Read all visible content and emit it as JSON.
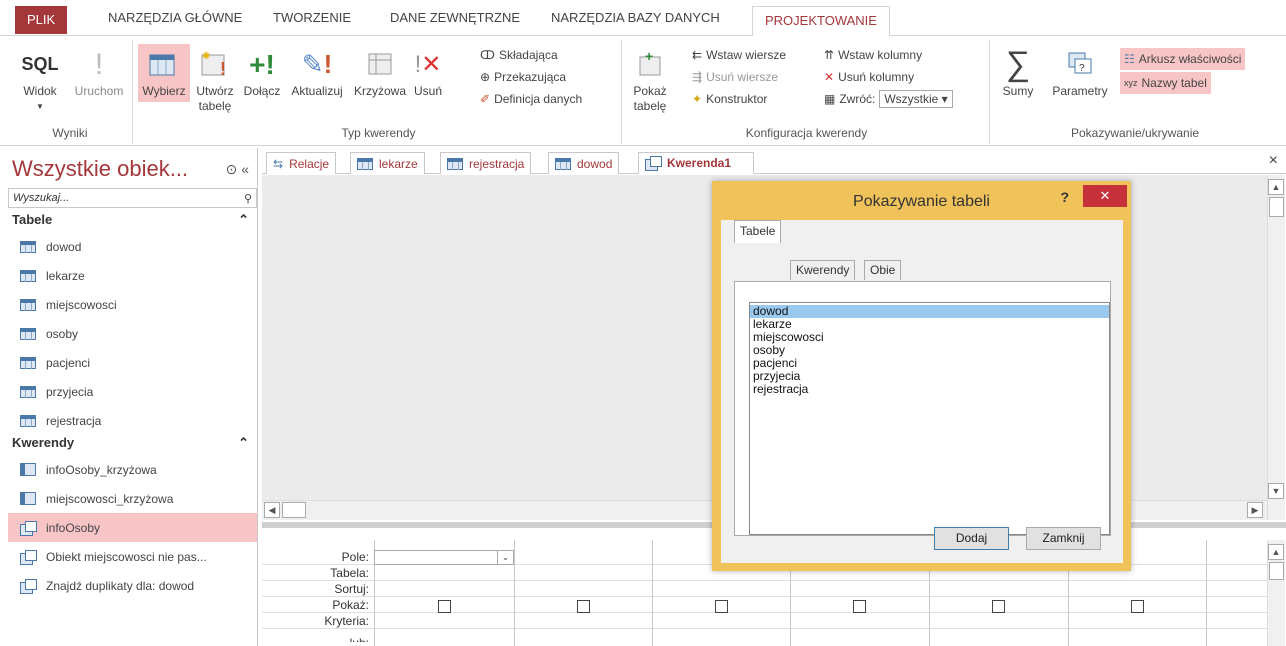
{
  "ribbon_tabs": [
    "PLIK",
    "NARZĘDZIA GŁÓWNE",
    "TWORZENIE",
    "DANE ZEWNĘTRZNE",
    "NARZĘDZIA BAZY DANYCH",
    "PROJEKTOWANIE"
  ],
  "ribbon": {
    "wyniki": {
      "label": "Wyniki",
      "widok": "Widok",
      "sql": "SQL",
      "uruchom": "Uruchom"
    },
    "typ": {
      "label": "Typ kwerendy",
      "wybierz": "Wybierz",
      "utworz1": "Utwórz",
      "utworz2": "tabelę",
      "dolacz": "Dołącz",
      "aktualizuj": "Aktualizuj",
      "krzyzowa": "Krzyżowa",
      "usun": "Usuń",
      "skladajaca": "Składająca",
      "przekazujaca": "Przekazująca",
      "definicja": "Definicja danych"
    },
    "konf": {
      "label": "Konfiguracja kwerendy",
      "pokaz1": "Pokaż",
      "pokaz2": "tabelę",
      "wstaw_wiersze": "Wstaw wiersze",
      "usun_wiersze": "Usuń wiersze",
      "konstruktor": "Konstruktor",
      "wstaw_kolumny": "Wstaw kolumny",
      "usun_kolumny": "Usuń kolumny",
      "zwroc": "Zwróć:",
      "zwroc_val": "Wszystkie"
    },
    "pokaz": {
      "label": "Pokazywanie/ukrywanie",
      "sumy": "Sumy",
      "parametry": "Parametry",
      "arkusz": "Arkusz właściwości",
      "nazwy": "Nazwy tabel"
    }
  },
  "nav": {
    "title": "Wszystkie obiek...",
    "search_placeholder": "Wyszukaj...",
    "tables_header": "Tabele",
    "tables": [
      "dowod",
      "lekarze",
      "miejscowosci",
      "osoby",
      "pacjenci",
      "przyjecia",
      "rejestracja"
    ],
    "queries_header": "Kwerendy",
    "queries": [
      "infoOsoby_krzyżowa",
      "miejscowosci_krzyżowa",
      "infoOsoby",
      "Obiekt miejscowosci nie pas...",
      "Znajdź duplikaty dla: dowod"
    ]
  },
  "doc_tabs": [
    "Relacje",
    "lekarze",
    "rejestracja",
    "dowod",
    "Kwerenda1"
  ],
  "grid_labels": [
    "Pole:",
    "Tabela:",
    "Sortuj:",
    "Pokaż:",
    "Kryteria:",
    "lub:"
  ],
  "dialog": {
    "title": "Pokazywanie tabeli",
    "help": "?",
    "tabs": [
      "Tabele",
      "Kwerendy",
      "Obie"
    ],
    "items": [
      "dowod",
      "lekarze",
      "miejscowosci",
      "osoby",
      "pacjenci",
      "przyjecia",
      "rejestracja"
    ],
    "add": "Dodaj",
    "close": "Zamknij"
  }
}
